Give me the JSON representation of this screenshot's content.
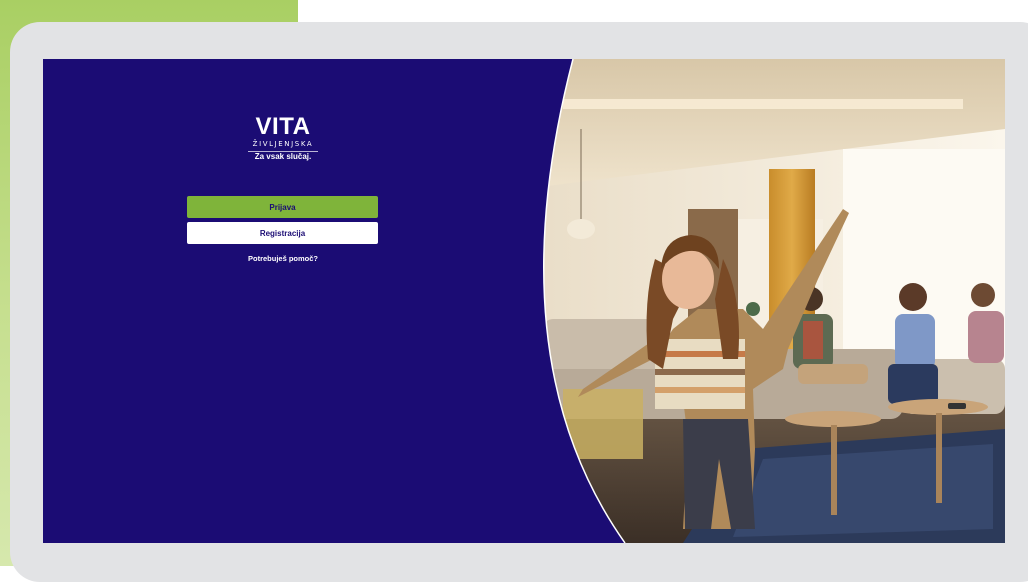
{
  "brand": {
    "logo_main": "VITA",
    "logo_sub": "ŽIVLJENJSKA",
    "tagline": "Za vsak slučaj."
  },
  "actions": {
    "login_label": "Prijava",
    "register_label": "Registracija",
    "help_label": "Potrebuješ pomoč?"
  },
  "colors": {
    "brand_navy": "#1b0c74",
    "brand_green": "#7fb43a",
    "frame_gray": "#e2e3e5",
    "accent_lime": "#a9cf63"
  },
  "hero": {
    "subject": "family-living-room-photo"
  }
}
